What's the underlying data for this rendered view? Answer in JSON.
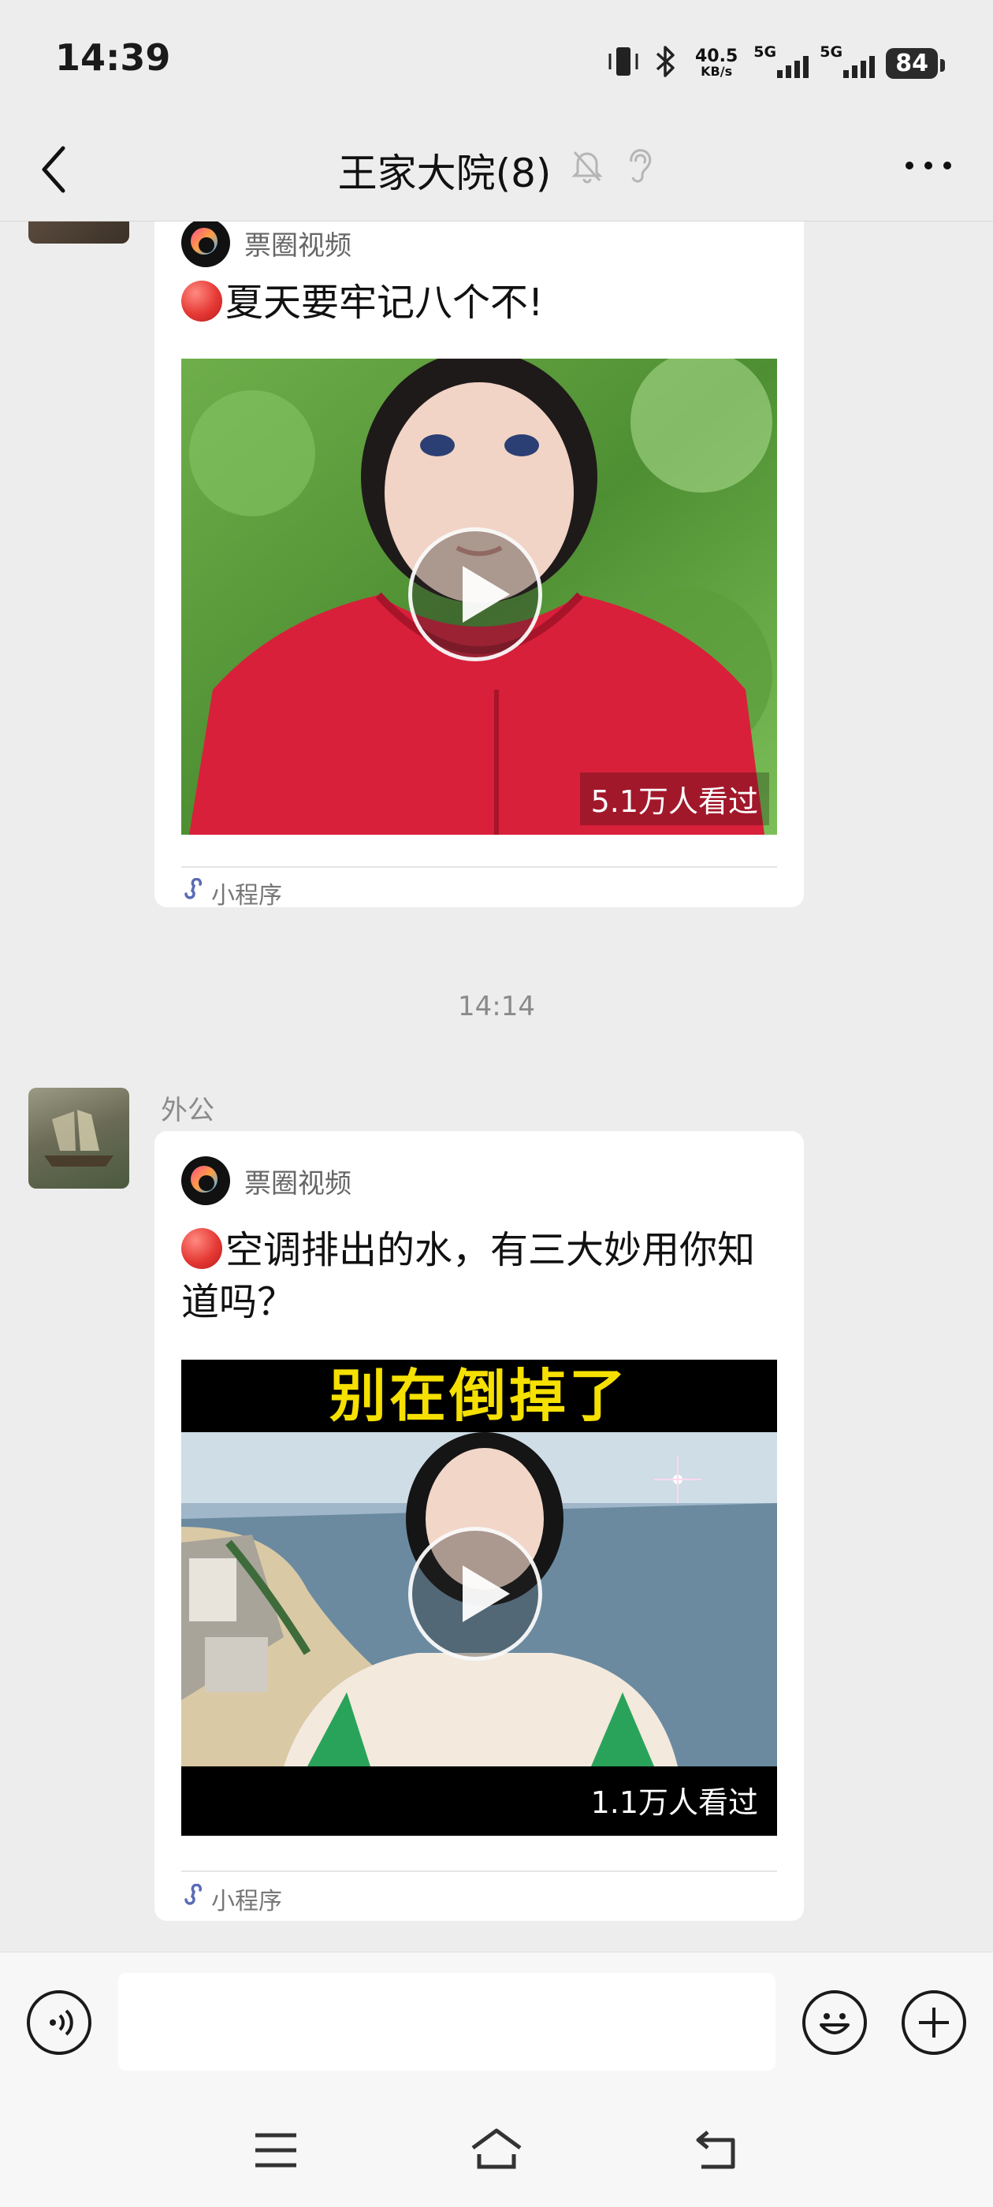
{
  "status_bar": {
    "time": "14:39",
    "net_speed_value": "40.5",
    "net_speed_unit": "KB/s",
    "signal1_label": "5G",
    "signal2_label": "5G",
    "battery": "84"
  },
  "nav": {
    "title": "王家大院(8)",
    "icons": [
      "back-icon",
      "mute-bell-icon",
      "ear-icon",
      "more-icon"
    ]
  },
  "messages": [
    {
      "source": "票圈视频",
      "title": "夏天要牢记八个不!",
      "views": "5.1万人看过",
      "mini_label": "小程序"
    },
    {
      "timestamp": "14:14",
      "sender": "外公",
      "source": "票圈视频",
      "title": "空调排出的水，有三大妙用你知道吗？",
      "thumb_banner": "别在倒掉了",
      "views": "1.1万人看过",
      "mini_label": "小程序"
    }
  ],
  "input_bar": {
    "text_value": "",
    "icons": [
      "voice-icon",
      "emoji-icon",
      "add-icon"
    ]
  },
  "system_nav": {
    "icons": [
      "menu-icon",
      "home-icon",
      "back-system-icon"
    ]
  },
  "colors": {
    "background": "#ededed",
    "card": "#ffffff",
    "red_dot": "#e53935"
  }
}
